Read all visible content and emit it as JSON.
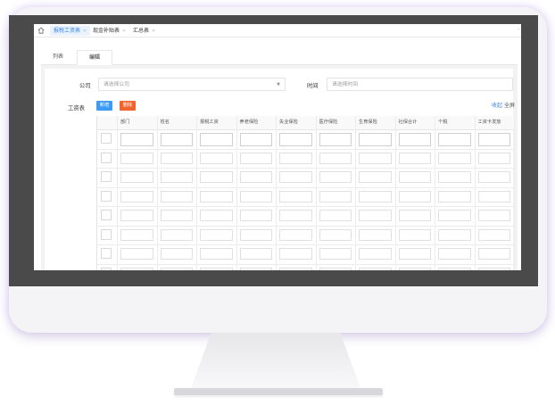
{
  "top_tabs": [
    {
      "label": "报税工资表",
      "active": true
    },
    {
      "label": "现金补贴表",
      "active": false
    },
    {
      "label": "汇总表",
      "active": false
    }
  ],
  "sub_tabs": [
    {
      "label": "列表",
      "active": false
    },
    {
      "label": "编辑",
      "active": true
    }
  ],
  "form": {
    "company_label": "公司",
    "company_placeholder": "请选择公司",
    "time_label": "时间",
    "time_placeholder": "请选择时间",
    "payroll_label": "工资表"
  },
  "toolbar": {
    "add_label": "新增",
    "delete_label": "删除",
    "collapse_label": "收起",
    "fullscreen_label": "全屏"
  },
  "table": {
    "columns": [
      "部门",
      "姓名",
      "报税工资",
      "养老保险",
      "失业保险",
      "医疗保险",
      "生育保险",
      "社保合计",
      "个税",
      "工资卡发放"
    ],
    "empty_rows": 7
  },
  "colors": {
    "accent": "#3c9cf5",
    "danger": "#f0652f",
    "active_tab_bg": "#e9f2fe"
  }
}
